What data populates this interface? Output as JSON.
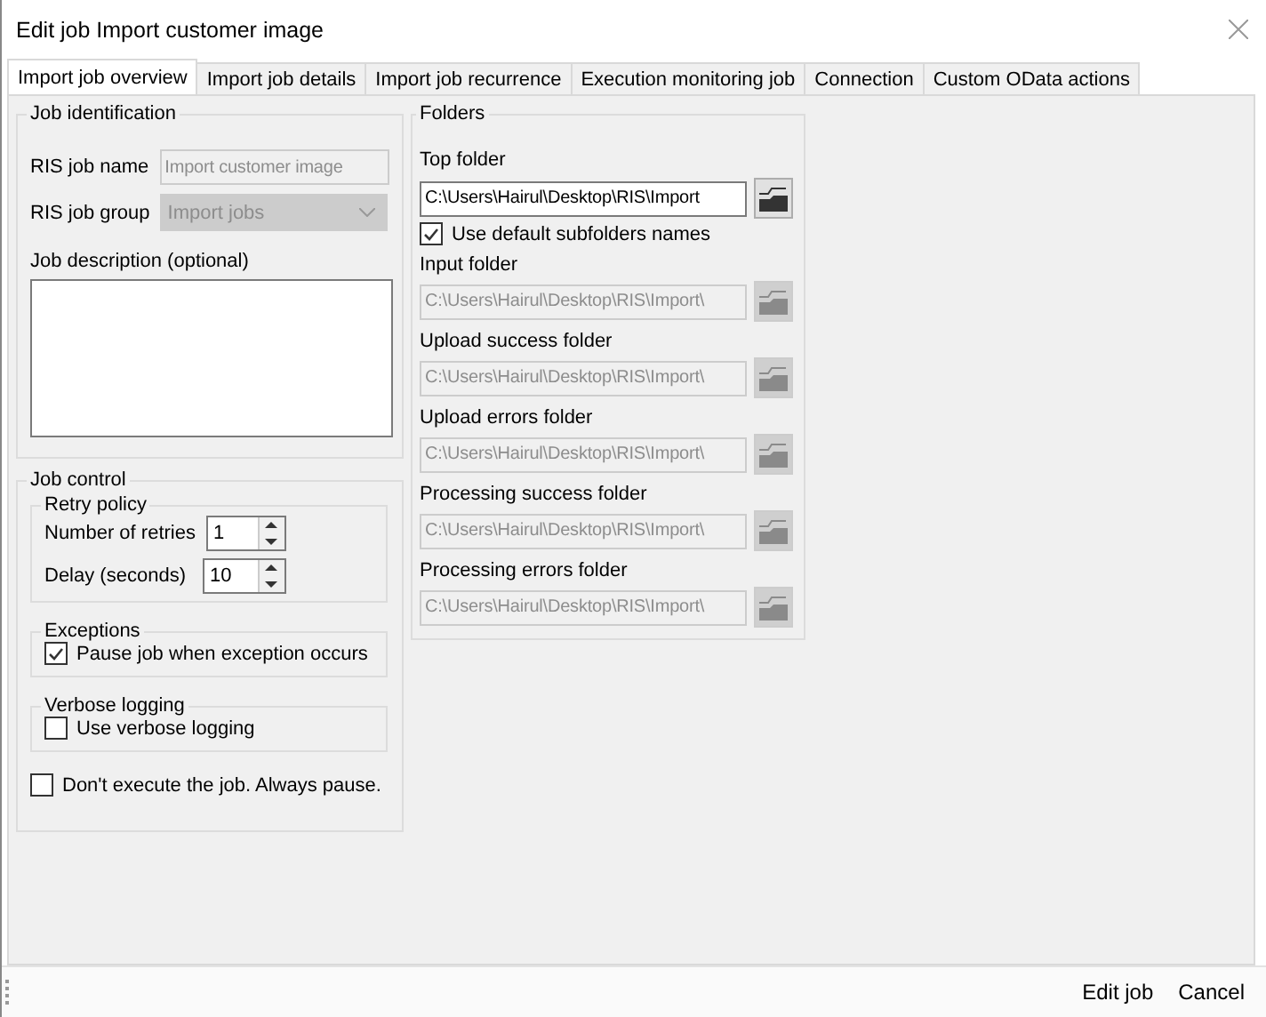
{
  "window": {
    "title": "Edit job Import customer image"
  },
  "tabs": [
    {
      "label": "Import job overview",
      "selected": true
    },
    {
      "label": "Import job details",
      "selected": false
    },
    {
      "label": "Import job recurrence",
      "selected": false
    },
    {
      "label": "Execution monitoring job",
      "selected": false
    },
    {
      "label": "Connection",
      "selected": false
    },
    {
      "label": "Custom OData actions",
      "selected": false
    }
  ],
  "job_identification": {
    "title": "Job identification",
    "fields": [
      {
        "label": "RIS job name",
        "kind": "text",
        "value": "Import customer image",
        "disabled": true
      },
      {
        "label": "RIS job group",
        "kind": "dropdown",
        "value": "Import jobs",
        "disabled": true
      }
    ],
    "description": {
      "label": "Job description (optional)"
    }
  },
  "job_control": {
    "title": "Job control",
    "retry_policy": {
      "title": "Retry policy",
      "spinners": [
        {
          "label": "Number of retries",
          "value": "1"
        },
        {
          "label": "Delay (seconds)",
          "value": "10"
        }
      ]
    },
    "groups": [
      {
        "title": "Exceptions",
        "checkbox": {
          "label": "Pause job when exception occurs",
          "checked": true
        }
      },
      {
        "title": "Verbose logging",
        "checkbox": {
          "label": "Use verbose logging",
          "checked": false
        }
      }
    ],
    "pause": {
      "label": "Don't execute the job. Always pause.",
      "checked": false
    }
  },
  "folders": {
    "title": "Folders",
    "top": {
      "label": "Top folder",
      "value": "C:\\Users\\Hairul\\Desktop\\RIS\\Import",
      "disabled": false
    },
    "use_default": {
      "label": "Use default subfolders names",
      "checked": true
    },
    "subfolders": [
      {
        "label": "Input folder",
        "value": "C:\\Users\\Hairul\\Desktop\\RIS\\Import\\",
        "disabled": true
      },
      {
        "label": "Upload success folder",
        "value": "C:\\Users\\Hairul\\Desktop\\RIS\\Import\\",
        "disabled": true
      },
      {
        "label": "Upload errors folder",
        "value": "C:\\Users\\Hairul\\Desktop\\RIS\\Import\\",
        "disabled": true
      },
      {
        "label": "Processing success folder",
        "value": "C:\\Users\\Hairul\\Desktop\\RIS\\Import\\",
        "disabled": true
      },
      {
        "label": "Processing errors folder",
        "value": "C:\\Users\\Hairul\\Desktop\\RIS\\Import\\",
        "disabled": true
      }
    ]
  },
  "buttons": [
    {
      "label": "Edit job"
    },
    {
      "label": "Cancel"
    }
  ]
}
